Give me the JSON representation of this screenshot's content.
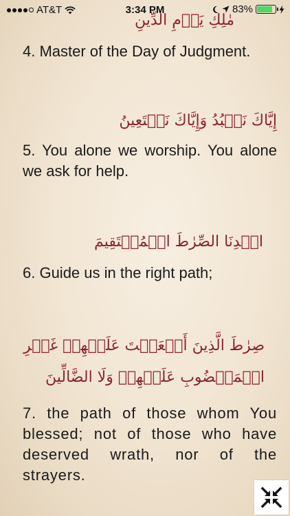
{
  "status_bar": {
    "carrier": "AT&T",
    "time": "3:34 PM",
    "battery_percent": "83%",
    "battery_level": 0.83,
    "battery_color": "#4cd964"
  },
  "verses": [
    {
      "arabic": "مٰلِكِ يَوۡمِ الدِّينِ",
      "english": "4. Master of the Day of Judgment."
    },
    {
      "arabic": "إِيَّاكَ نَعۡبُدُ وَإِيَّاكَ نَسۡتَعِينُ",
      "english": "5. You alone we worship. You alone we ask for help."
    },
    {
      "arabic": "اهۡدِنَا الصِّرٰطَ الۡمُسۡتَقِيمَ",
      "english": "6. Guide us in the right path;"
    },
    {
      "arabic": "صِرٰطَ الَّذِينَ أَنۡعَمۡتَ عَلَيۡهِمۡ غَيۡرِ الۡمَغۡضُوبِ عَلَيۡهِمۡ وَلَا الضَّالِّينَ",
      "english": "7. the path of those whom You blessed; not of those who have deserved wrath, nor of the strayers."
    }
  ],
  "icons": {
    "wifi": "wifi-icon",
    "moon": "moon-icon",
    "location": "location-arrow-icon",
    "battery": "battery-icon",
    "charging": "charging-bolt-icon",
    "collapse": "collapse-icon"
  },
  "colors": {
    "arabic_text": "#8b2430",
    "english_text": "#1a1a1a"
  }
}
